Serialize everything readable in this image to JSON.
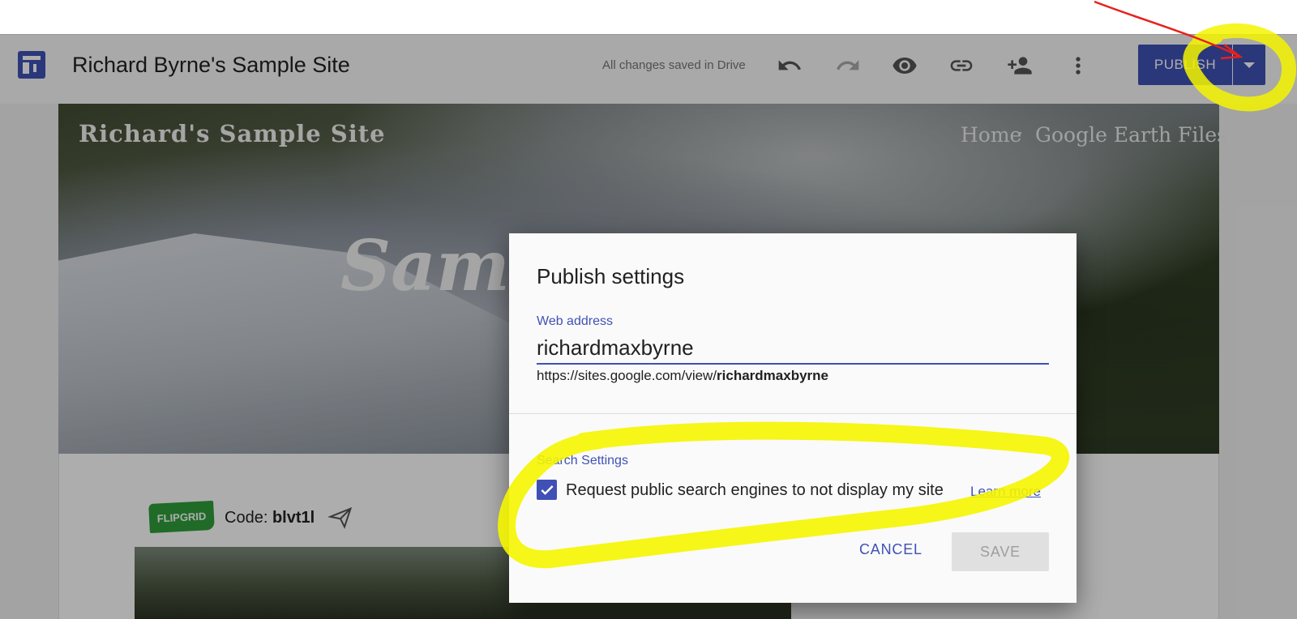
{
  "toolbar": {
    "site_title": "Richard Byrne's Sample Site",
    "save_status": "All changes saved in Drive",
    "publish_label": "PUBLISH",
    "icons": [
      "undo-icon",
      "redo-icon",
      "preview-icon",
      "link-icon",
      "share-icon",
      "more-icon"
    ]
  },
  "site": {
    "name": "Richard's Sample Site",
    "nav": [
      "Home",
      "Google Earth Files"
    ],
    "hero_text": "Samp",
    "flipgrid_label": "FLIPGRID",
    "code_prefix": "Code:",
    "code_value": "blvt1l"
  },
  "dialog": {
    "title": "Publish settings",
    "web_address_label": "Web address",
    "web_address_value": "richardmaxbyrne",
    "url_prefix": "https://sites.google.com/view/",
    "url_slug": "richardmaxbyrne",
    "search_section_label": "Search Settings",
    "checkbox_label": "Request public search engines to not display my site",
    "checkbox_checked": true,
    "learn_more": "Learn more",
    "cancel_label": "CANCEL",
    "save_label": "SAVE"
  },
  "colors": {
    "accent": "#3f51b5",
    "highlight": "#f5f500",
    "arrow": "#e8201c"
  }
}
